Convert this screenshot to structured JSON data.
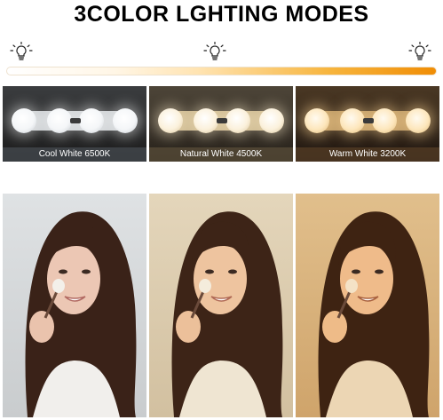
{
  "header": {
    "title": "3COLOR LGHTING MODES"
  },
  "scale": {
    "icons": [
      "lightbulb-icon",
      "lightbulb-icon",
      "lightbulb-icon"
    ],
    "gradient_colors": [
      "#ffffff",
      "#ffe3b0",
      "#f08d05"
    ]
  },
  "modes": [
    {
      "label": "Cool White 6500K",
      "tint": "#e9ebec"
    },
    {
      "label": "Natural White 4500K",
      "tint": "#e8dcc3"
    },
    {
      "label": "Warm White 3200K",
      "tint": "#dcb98a"
    }
  ]
}
